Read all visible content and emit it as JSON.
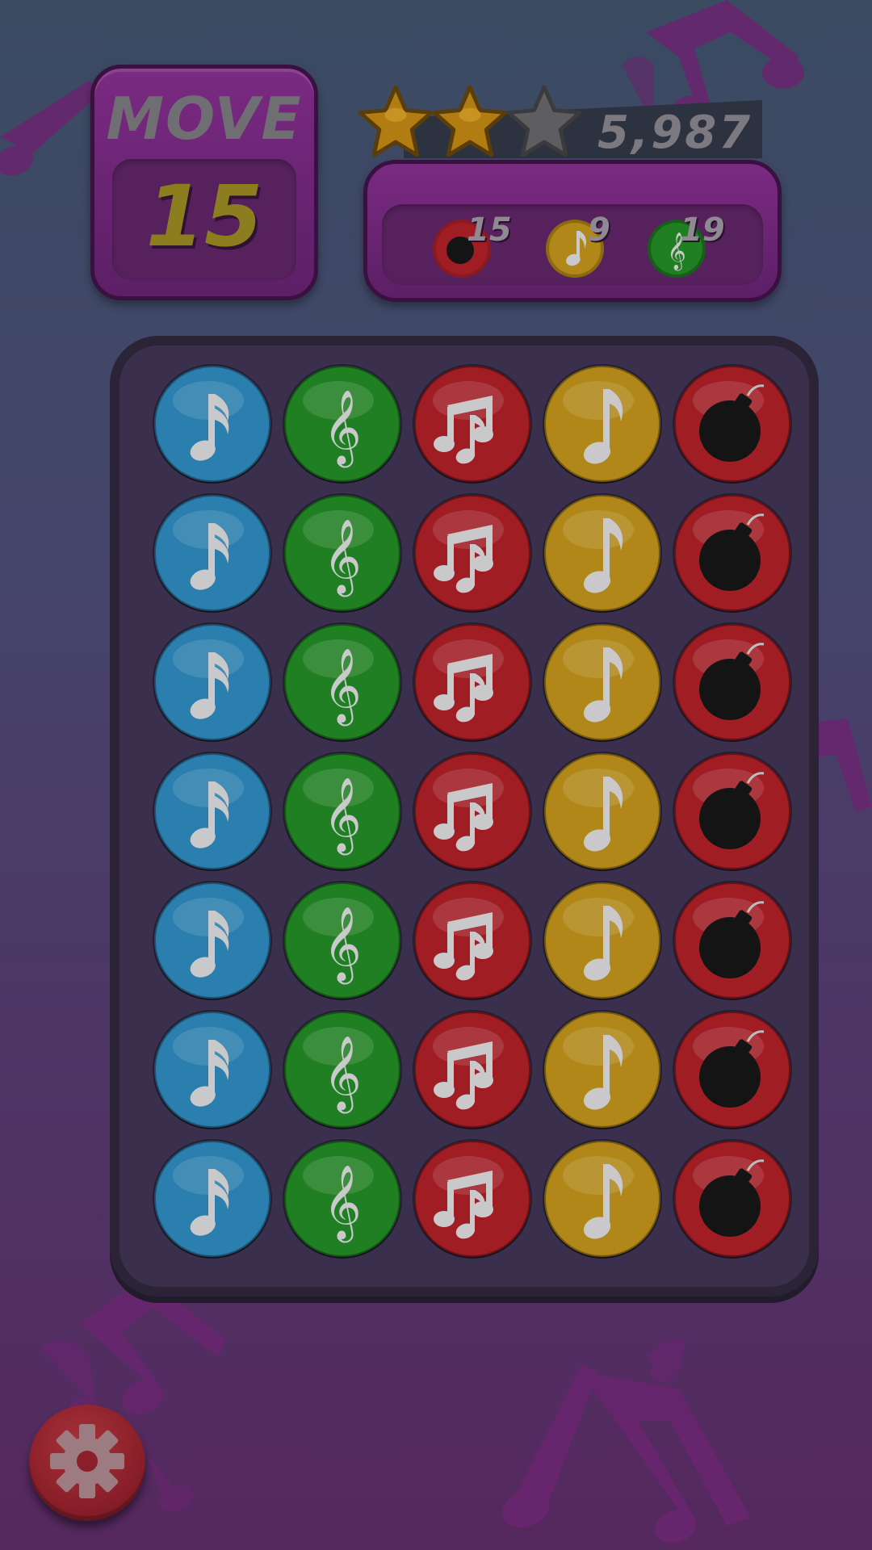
{
  "move": {
    "label": "MOVE",
    "count": "15"
  },
  "score": {
    "value": "5,987",
    "stars_earned": 2,
    "stars_total": 3
  },
  "goals": [
    {
      "icon": "bomb-icon",
      "color": "red",
      "count": "15"
    },
    {
      "icon": "eighth-note-icon",
      "color": "yellow",
      "count": "9"
    },
    {
      "icon": "treble-clef-icon",
      "color": "green",
      "count": "19"
    }
  ],
  "board": {
    "rows": 7,
    "columns": [
      {
        "color": "blue",
        "icon": "sixteenth-note-icon"
      },
      {
        "color": "green",
        "icon": "treble-clef-icon"
      },
      {
        "color": "red",
        "icon": "beamed-notes-icon"
      },
      {
        "color": "yellow",
        "icon": "eighth-note-icon"
      },
      {
        "color": "red",
        "icon": "bomb-icon"
      }
    ]
  },
  "colors": {
    "blue": "#2a7fae",
    "green": "#1f7f22",
    "red": "#a01d24",
    "yellow": "#b08718",
    "glyph": "#c9c9cc",
    "bomb": "#141414"
  },
  "settings": {
    "icon": "gear-icon"
  }
}
